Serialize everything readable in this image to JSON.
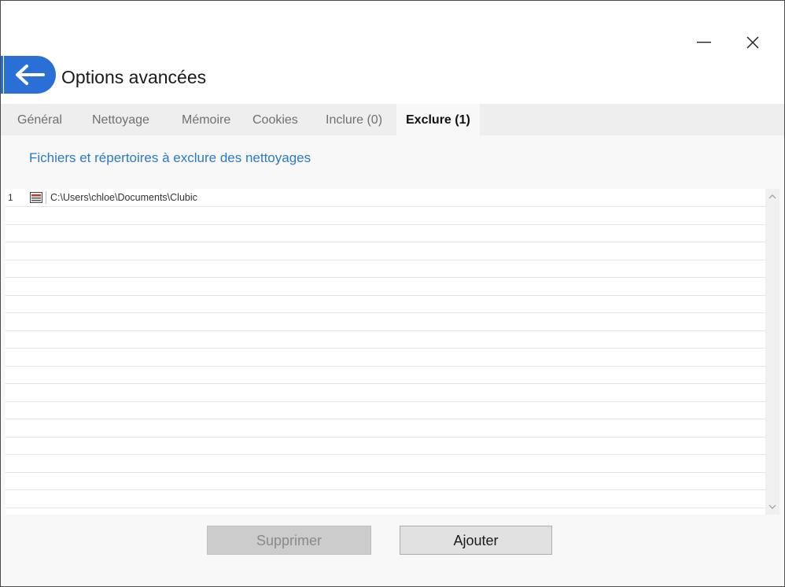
{
  "window": {
    "title": "Options avancées",
    "controls": {
      "minimize_icon": "minimize-icon",
      "close_icon": "close-icon"
    }
  },
  "header": {
    "back_icon": "arrow-left-icon",
    "accent_color": "#2a6fd6"
  },
  "tabs": [
    {
      "label": "Général",
      "active": false
    },
    {
      "label": "Nettoyage",
      "active": false
    },
    {
      "label": "Mémoire",
      "active": false
    },
    {
      "label": "Cookies",
      "active": false
    },
    {
      "label": "Inclure (0)",
      "active": false
    },
    {
      "label": "Exclure (1)",
      "active": true
    }
  ],
  "section": {
    "heading": "Fichiers et répertoires à exclure des nettoyages",
    "heading_color": "#2a7ac4"
  },
  "exclusions": {
    "items": [
      {
        "number": "1",
        "icon": "drive-icon",
        "path": "C:\\Users\\chloe\\Documents\\Clubic"
      }
    ]
  },
  "buttons": {
    "delete_label": "Supprimer",
    "delete_enabled": false,
    "add_label": "Ajouter"
  }
}
